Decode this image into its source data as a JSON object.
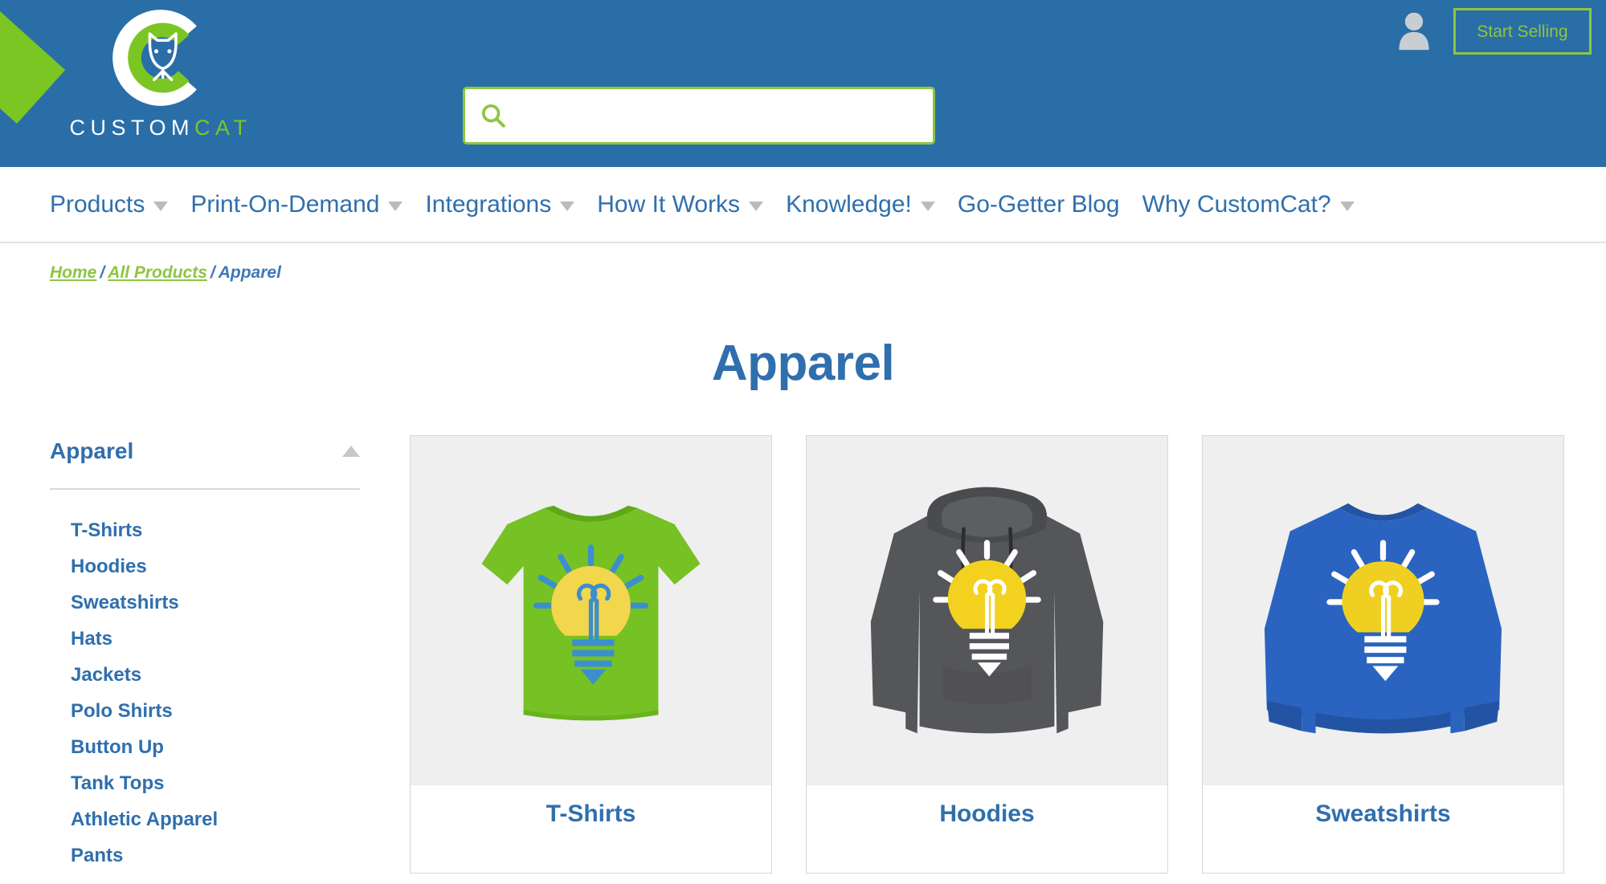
{
  "brand": {
    "logo_text_primary": "CUSTOM",
    "logo_text_accent": "CAT",
    "logo_icon": "customcat-c-cat-logo",
    "color_blue": "#2a6ea8",
    "color_green": "#8cc63f",
    "color_link_blue": "#2f6fad"
  },
  "header": {
    "search": {
      "value": "",
      "placeholder": "",
      "icon": "search-icon"
    },
    "account": {
      "icon": "user-avatar-icon"
    },
    "cta": {
      "label": "Start Selling"
    }
  },
  "nav": {
    "items": [
      {
        "label": "Products",
        "has_dropdown": true
      },
      {
        "label": "Print-On-Demand",
        "has_dropdown": true
      },
      {
        "label": "Integrations",
        "has_dropdown": true
      },
      {
        "label": "How It Works",
        "has_dropdown": true
      },
      {
        "label": "Knowledge!",
        "has_dropdown": true
      },
      {
        "label": "Go-Getter Blog",
        "has_dropdown": false
      },
      {
        "label": "Why CustomCat?",
        "has_dropdown": true
      }
    ]
  },
  "breadcrumb": {
    "home": "Home",
    "all_products": "All Products",
    "current": "Apparel",
    "separator": "/"
  },
  "page": {
    "title": "Apparel"
  },
  "sidebar": {
    "title": "Apparel",
    "collapse_icon": "caret-up-icon",
    "items": [
      {
        "label": "T-Shirts"
      },
      {
        "label": "Hoodies"
      },
      {
        "label": "Sweatshirts"
      },
      {
        "label": "Hats"
      },
      {
        "label": "Jackets"
      },
      {
        "label": "Polo Shirts"
      },
      {
        "label": "Button Up"
      },
      {
        "label": "Tank Tops"
      },
      {
        "label": "Athletic Apparel"
      },
      {
        "label": "Pants"
      }
    ]
  },
  "products": [
    {
      "label": "T-Shirts",
      "image_alt": "green t-shirt with yellow lightbulb print",
      "garment_color": "#76c124",
      "garment_shadow": "#5fa817",
      "bulb_color": "#f2d64b",
      "ray_color": "#3b8fcf",
      "detail_color": "#3b8fcf"
    },
    {
      "label": "Hoodies",
      "image_alt": "dark heather grey hoodie with yellow lightbulb print",
      "garment_color": "#55565a",
      "garment_shadow": "#424347",
      "bulb_color": "#f2d21f",
      "ray_color": "#ffffff",
      "detail_color": "#ffffff"
    },
    {
      "label": "Sweatshirts",
      "image_alt": "royal blue crewneck sweatshirt with yellow lightbulb print",
      "garment_color": "#2a64c0",
      "garment_shadow": "#2354a3",
      "bulb_color": "#efd022",
      "ray_color": "#ffffff",
      "detail_color": "#ffffff"
    }
  ]
}
